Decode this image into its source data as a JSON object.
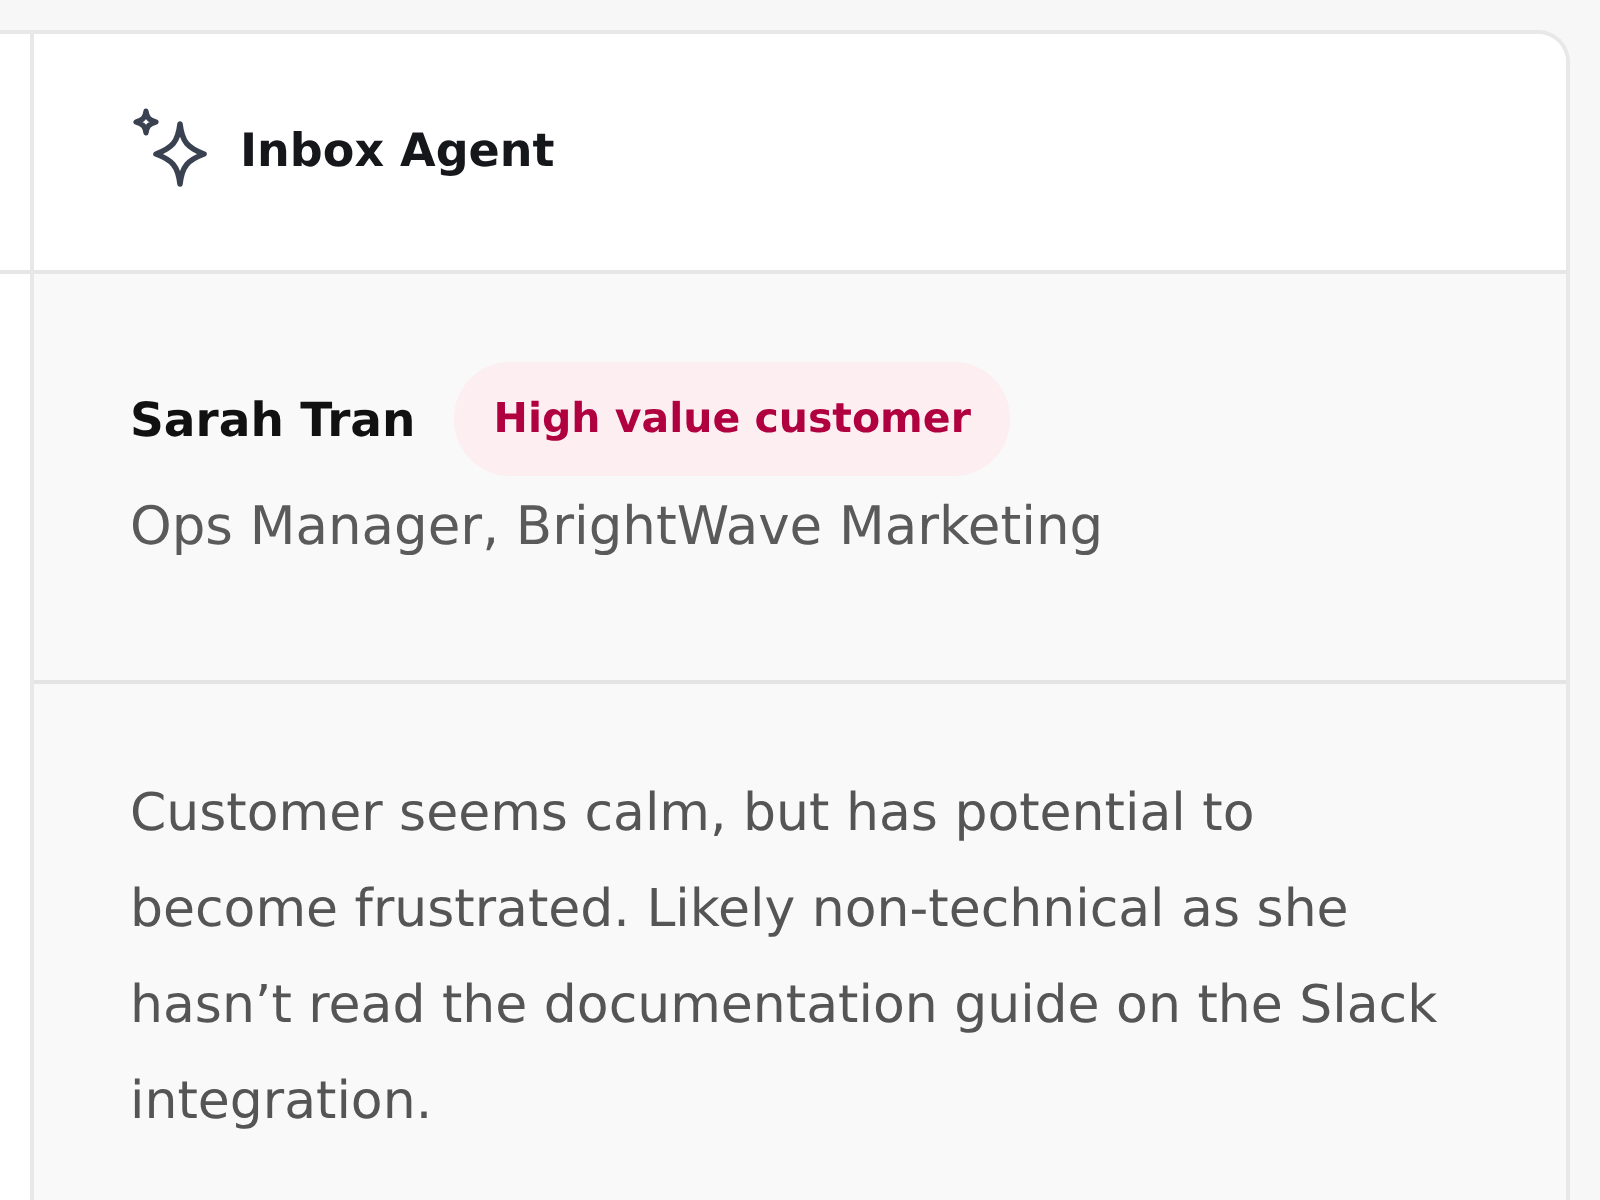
{
  "header": {
    "title": "Inbox Agent"
  },
  "customer": {
    "name": "Sarah Tran",
    "badge": "High value customer",
    "role": "Ops Manager, BrightWave Marketing"
  },
  "summary": "Customer seems calm, but has potential to become frustrated. Likely non-technical as she hasn’t read the documentation guide on the Slack integration."
}
